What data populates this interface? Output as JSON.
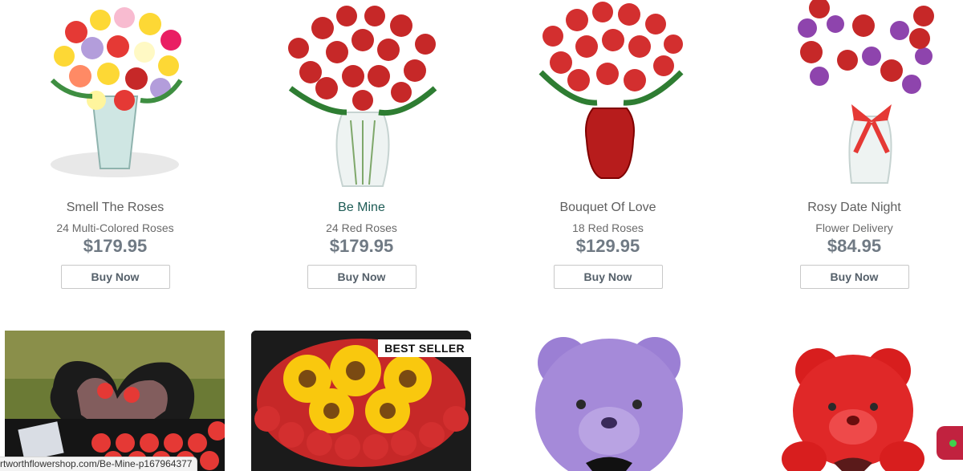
{
  "products": [
    {
      "name": "Smell The Roses",
      "subtitle": "24 Multi-Colored Roses",
      "price": "$179.95",
      "button": "Buy Now",
      "image": "multicolor-roses-bouquet-image"
    },
    {
      "name": "Be Mine",
      "subtitle": "24 Red Roses",
      "price": "$179.95",
      "button": "Buy Now",
      "image": "red-roses-clear-vase-image"
    },
    {
      "name": "Bouquet Of Love",
      "subtitle": "18 Red Roses",
      "price": "$129.95",
      "button": "Buy Now",
      "image": "red-roses-red-vase-image"
    },
    {
      "name": "Rosy Date Night",
      "subtitle": "Flower Delivery",
      "price": "$84.95",
      "button": "Buy Now",
      "image": "roses-purple-flowers-image"
    }
  ],
  "second_row": {
    "badge": "BEST SELLER",
    "tiles": [
      "heart-box-roses-image",
      "sunflower-roses-box-image",
      "purple-rose-bear-image",
      "red-rose-bear-image"
    ]
  },
  "status_url": "rtworthflowershop.com/Be-Mine-p167964377",
  "colors": {
    "link_active": "#1d5b55",
    "price": "#707a84",
    "chat_button": "#c1223f",
    "online_dot": "#3fd14d"
  }
}
